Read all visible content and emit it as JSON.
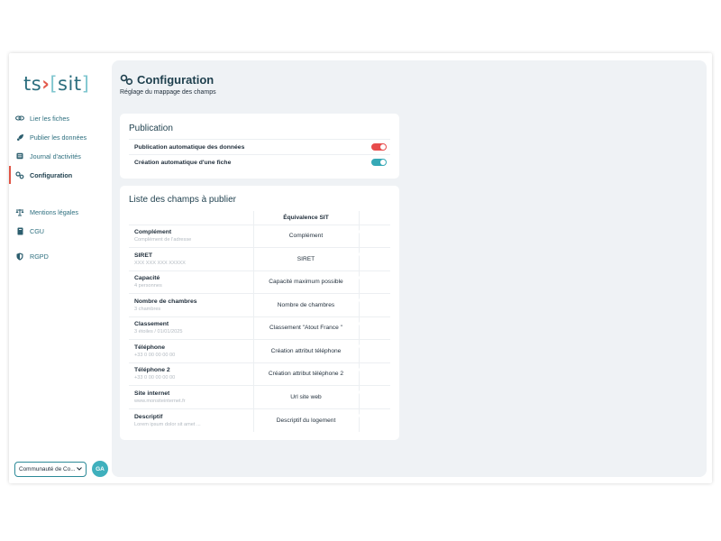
{
  "sidebar": {
    "logo": {
      "left": "ts",
      "sep": "›",
      "open": "[",
      "right": "sit",
      "close": "]"
    },
    "items": [
      {
        "label": "Lier les fiches",
        "icon": "link-icon",
        "active": false
      },
      {
        "label": "Publier les données",
        "icon": "rocket-icon",
        "active": false
      },
      {
        "label": "Journal d'activités",
        "icon": "journal-icon",
        "active": false
      },
      {
        "label": "Configuration",
        "icon": "gears-icon",
        "active": true
      },
      {
        "label": "Mentions légales",
        "icon": "scale-icon",
        "active": false
      },
      {
        "label": "CGU",
        "icon": "book-icon",
        "active": false
      },
      {
        "label": "RGPD",
        "icon": "shield-icon",
        "active": false
      }
    ],
    "community_select": "Communauté de Co...",
    "avatar_initials": "GA"
  },
  "header": {
    "title": "Configuration",
    "subtitle": "Réglage du mappage des champs"
  },
  "publication": {
    "title": "Publication",
    "rows": [
      {
        "label": "Publication automatique des données",
        "state": "off"
      },
      {
        "label": "Création automatique d'une fiche",
        "state": "on"
      }
    ]
  },
  "fields": {
    "title": "Liste des champs à publier",
    "column_header": "Équivalence SIT",
    "rows": [
      {
        "name": "Complément",
        "placeholder": "Complément de l'adresse",
        "equivalence": "Complément",
        "state": "on"
      },
      {
        "name": "SIRET",
        "placeholder": "XXX XXX XXX XXXXX",
        "equivalence": "SIRET",
        "state": "on"
      },
      {
        "name": "Capacité",
        "placeholder": "4 personnes",
        "equivalence": "Capacité maximum possible",
        "state": "on"
      },
      {
        "name": "Nombre de chambres",
        "placeholder": "3 chambres",
        "equivalence": "Nombre de chambres",
        "state": "on"
      },
      {
        "name": "Classement",
        "placeholder": "3 étoiles / 01/01/2025",
        "equivalence": "Classement \"Atout France \"",
        "state": "on"
      },
      {
        "name": "Téléphone",
        "placeholder": "+33 0 00 00 00 00",
        "equivalence": "Création attribut téléphone",
        "state": "on"
      },
      {
        "name": "Téléphone 2",
        "placeholder": "+33 0 00 00 00 00",
        "equivalence": "Création attribut téléphone 2",
        "state": "on"
      },
      {
        "name": "Site internet",
        "placeholder": "www.monsiteinternet.fr",
        "equivalence": "Url site web",
        "state": "on"
      },
      {
        "name": "Descriptif",
        "placeholder": "Lorem ipsum dolor sit amet ...",
        "equivalence": "Descriptif du logement",
        "state": "on"
      }
    ]
  },
  "colors": {
    "accent": "#36a9b6",
    "danger": "#e84c4c",
    "active_marker": "#e05444",
    "brand": "#2c6e7e"
  }
}
